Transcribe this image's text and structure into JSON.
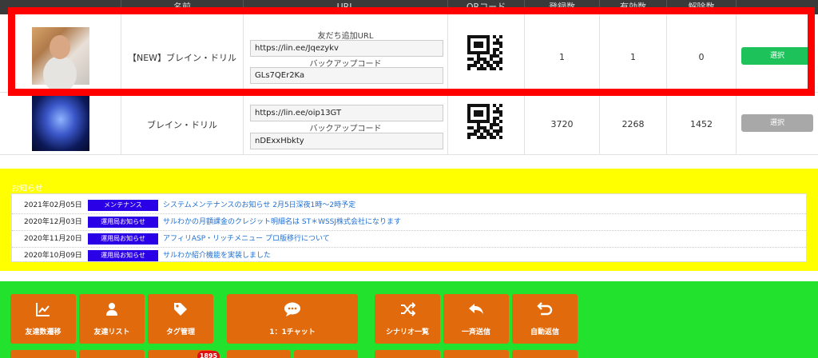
{
  "table": {
    "headers": [
      "",
      "名前",
      "URL",
      "QRコード",
      "登録数",
      "有効数",
      "解除数",
      ""
    ],
    "rows": [
      {
        "name": "【NEW】ブレイン・ドリル",
        "friend_url_label": "友だち追加URL",
        "friend_url": "https://lin.ee/Jqezykv",
        "backup_label": "バックアップコード",
        "backup_code": "GLs7QEr2Ka",
        "registered": "1",
        "active": "1",
        "unsubscribed": "0",
        "select_label": "選択",
        "select_color": "#1ec25a"
      },
      {
        "name": "ブレイン・ドリル",
        "friend_url": "https://lin.ee/oip13GT",
        "backup_label": "バックアップコード",
        "backup_code": "nDExxHbkty",
        "registered": "3720",
        "active": "2268",
        "unsubscribed": "1452",
        "select_label": "選択",
        "select_color": "#a8a8a8"
      }
    ]
  },
  "notices": {
    "title": "お知らせ",
    "items": [
      {
        "date": "2021年02月05日",
        "category": "メンテナンス",
        "text": "システムメンテナンスのお知らせ 2月5日深夜1時～2時予定"
      },
      {
        "date": "2020年12月03日",
        "category": "運用局お知らせ",
        "text": "サルわかの月額課金のクレジット明細名は ST＊WSSJ株式会社になります"
      },
      {
        "date": "2020年11月20日",
        "category": "運用局お知らせ",
        "text": "アフィリASP・リッチメニュー プロ版移行について"
      },
      {
        "date": "2020年10月09日",
        "category": "運用局お知らせ",
        "text": "サルわか紹介機能を実装しました"
      }
    ]
  },
  "menu": {
    "tiles": [
      {
        "label": "友達数遷移",
        "icon": "line-chart-icon"
      },
      {
        "label": "友達リスト",
        "icon": "user-icon"
      },
      {
        "label": "タグ管理",
        "icon": "tags-icon"
      },
      {
        "label": "1：1チャット",
        "icon": "chat-icon"
      },
      {
        "label": "シナリオ一覧",
        "icon": "shuffle-icon"
      },
      {
        "label": "一斉送信",
        "icon": "reply-icon"
      },
      {
        "label": "自動返信",
        "icon": "return-icon"
      }
    ],
    "badge": "1895"
  },
  "colors": {
    "highlight": "#ff0000",
    "notice_bg": "#ffff00",
    "menu_bg": "#22e22e",
    "tile": "#e06a0c",
    "category_badge": "#2a00e6"
  }
}
